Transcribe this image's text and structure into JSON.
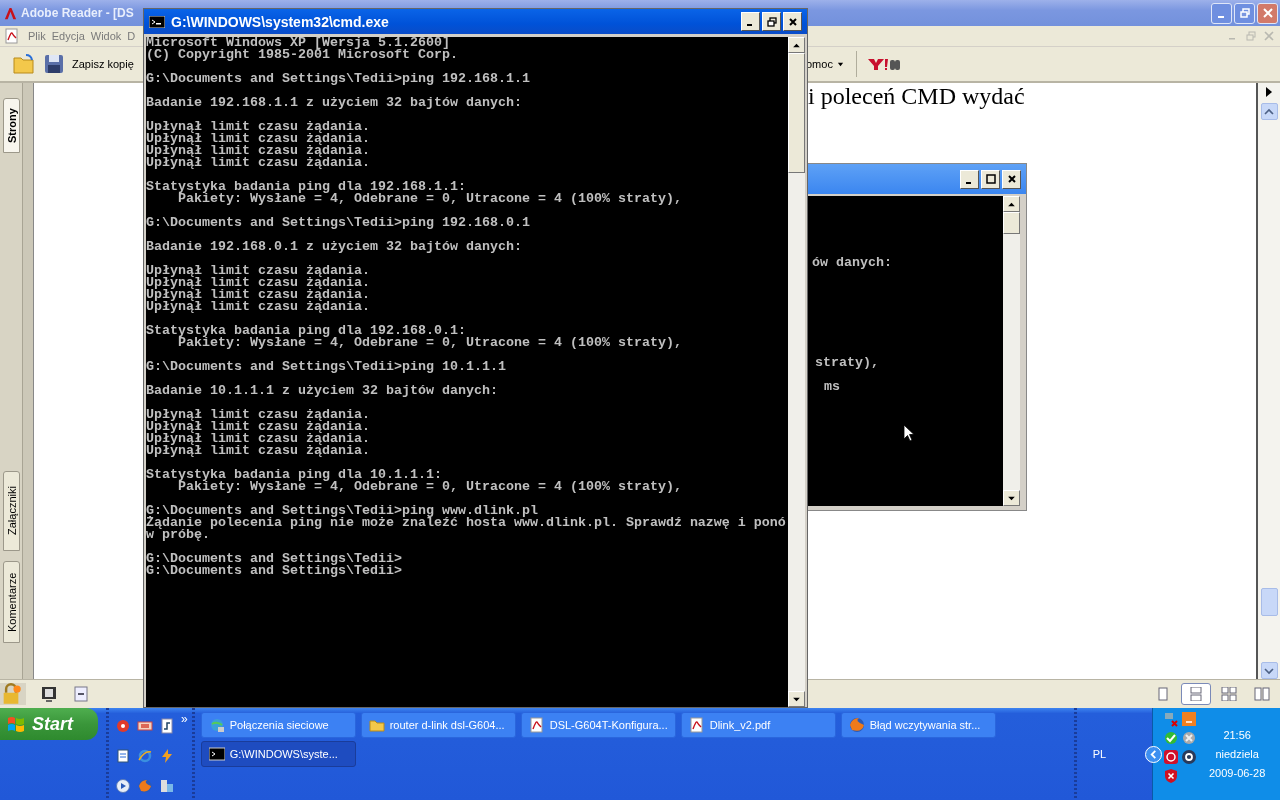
{
  "reader_window": {
    "title": "Adobe Reader - [DS",
    "menu": [
      "Plik",
      "Edycja",
      "Widok",
      "D"
    ],
    "toolbar": {
      "save_label": "Zapisz kopię",
      "help_label": "omoc"
    },
    "side_tabs": [
      {
        "label": "Strony",
        "selected": true
      },
      {
        "label": "Załączniki",
        "selected": false
      },
      {
        "label": "Komentarze",
        "selected": false
      }
    ],
    "document_text": "i poleceń CMD wydać",
    "view_buttons": [
      {
        "selected": false
      },
      {
        "selected": true
      },
      {
        "selected": false
      },
      {
        "selected": false
      }
    ]
  },
  "background_console": {
    "lines": [
      "ów danych:",
      "straty),",
      "ms"
    ]
  },
  "console_window": {
    "title": "G:\\WINDOWS\\system32\\cmd.exe",
    "blocks": [
      [
        "Microsoft Windows XP [Wersja 5.1.2600]",
        "(C) Copyright 1985-2001 Microsoft Corp."
      ],
      [
        "G:\\Documents and Settings\\Tedii>ping 192.168.1.1"
      ],
      [
        "Badanie 192.168.1.1 z użyciem 32 bajtów danych:"
      ],
      [
        "Upłynął limit czasu żądania.",
        "Upłynął limit czasu żądania.",
        "Upłynął limit czasu żądania.",
        "Upłynął limit czasu żądania."
      ],
      [
        "Statystyka badania ping dla 192.168.1.1:",
        "    Pakiety: Wysłane = 4, Odebrane = 0, Utracone = 4 (100% straty),"
      ],
      [
        "G:\\Documents and Settings\\Tedii>ping 192.168.0.1"
      ],
      [
        "Badanie 192.168.0.1 z użyciem 32 bajtów danych:"
      ],
      [
        "Upłynął limit czasu żądania.",
        "Upłynął limit czasu żądania.",
        "Upłynął limit czasu żądania.",
        "Upłynął limit czasu żądania."
      ],
      [
        "Statystyka badania ping dla 192.168.0.1:",
        "    Pakiety: Wysłane = 4, Odebrane = 0, Utracone = 4 (100% straty),"
      ],
      [
        "G:\\Documents and Settings\\Tedii>ping 10.1.1.1"
      ],
      [
        "Badanie 10.1.1.1 z użyciem 32 bajtów danych:"
      ],
      [
        "Upłynął limit czasu żądania.",
        "Upłynął limit czasu żądania.",
        "Upłynął limit czasu żądania.",
        "Upłynął limit czasu żądania."
      ],
      [
        "Statystyka badania ping dla 10.1.1.1:",
        "    Pakiety: Wysłane = 4, Odebrane = 0, Utracone = 4 (100% straty),"
      ],
      [
        "G:\\Documents and Settings\\Tedii>ping www.dlink.pl",
        "Żądanie polecenia ping nie może znaleźć hosta www.dlink.pl. Sprawdź nazwę i ponó",
        "w próbę."
      ],
      [
        "G:\\Documents and Settings\\Tedii>",
        "G:\\Documents and Settings\\Tedii>"
      ]
    ]
  },
  "taskbar": {
    "start_label": "Start",
    "more_label": "»",
    "tasks": [
      {
        "label": "Połączenia sieciowe",
        "kind": "network",
        "selected": false
      },
      {
        "label": "router d-link dsl-G604...",
        "kind": "folder",
        "selected": false
      },
      {
        "label": "DSL-G604T-Konfigura...",
        "kind": "pdf",
        "selected": false
      },
      {
        "label": "Dlink_v2.pdf",
        "kind": "pdf",
        "selected": false
      },
      {
        "label": "Błąd wczytywania str...",
        "kind": "firefox",
        "selected": false
      },
      {
        "label": "G:\\WINDOWS\\syste...",
        "kind": "console",
        "selected": true
      }
    ],
    "language": "PL",
    "time": "21:56",
    "day": "niedziela",
    "date": "2009-06-28"
  }
}
